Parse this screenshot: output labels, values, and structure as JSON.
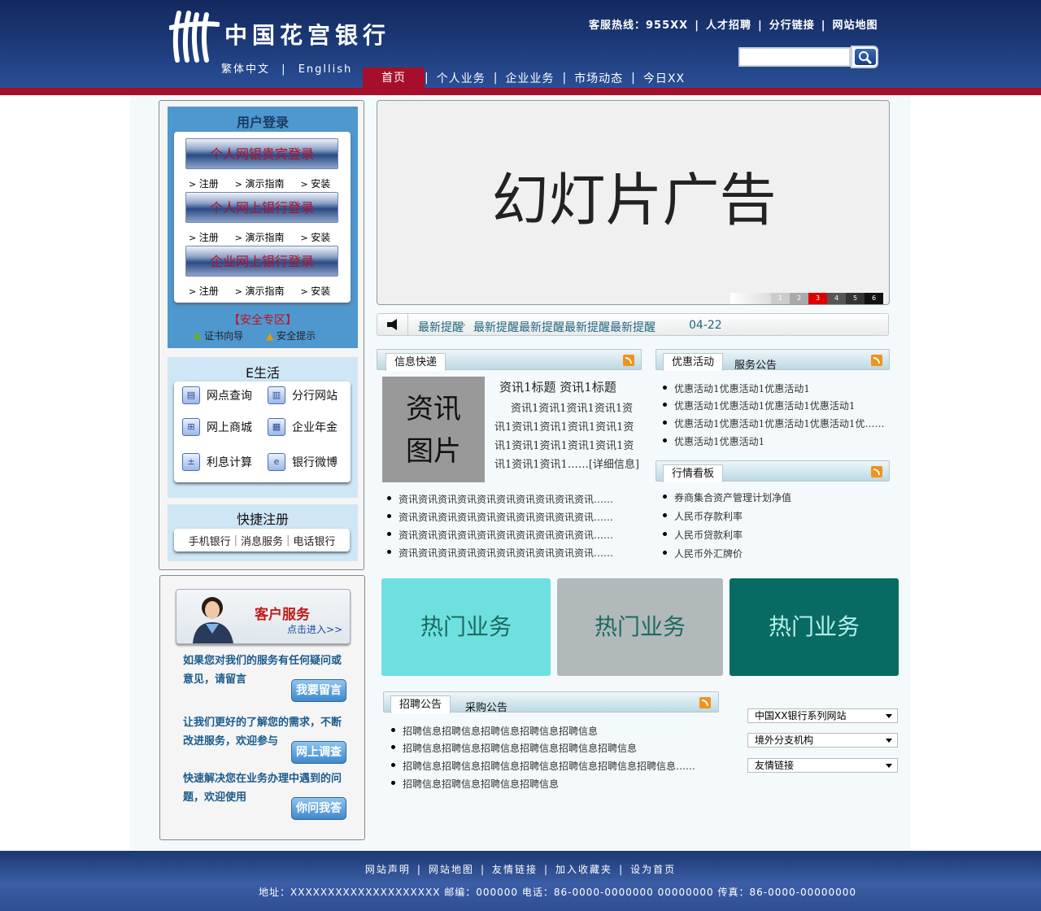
{
  "header": {
    "logo_text": "中国花宫银行",
    "lang_trad": "繁体中文",
    "lang_en": "Engllish",
    "top_links": [
      "客服热线：955XX",
      "人才招聘",
      "分行链接",
      "网站地图"
    ],
    "nav": [
      "首页",
      "个人业务",
      "企业业务",
      "市场动态",
      "今日XX"
    ],
    "search_placeholder": ""
  },
  "login": {
    "title": "用户登录",
    "buttons": [
      "个人网银贵宾登录",
      "个人网上银行登录",
      "企业网上银行登录"
    ],
    "links": [
      "注册",
      "演示指南",
      "安装"
    ],
    "safe_title": "【安全专区】",
    "safe_links": [
      "证书向导",
      "安全提示"
    ]
  },
  "elife": {
    "title": "E生活",
    "items": [
      "网点查询",
      "分行网站",
      "网上商城",
      "企业年金",
      "利息计算",
      "银行微博"
    ]
  },
  "quickreg": {
    "title": "快捷注册",
    "items": [
      "手机银行",
      "消息服务",
      "电话银行"
    ]
  },
  "cs": {
    "title": "客户服务",
    "sub": "点击进入>>",
    "blocks": [
      {
        "text": "如果您对我们的服务有任何疑问或意见，请留言",
        "button": "我要留言"
      },
      {
        "text": "让我们更好的了解您的需求，不断改进服务，欢迎参与",
        "button": "网上调查"
      },
      {
        "text": "快速解决您在业务办理中遇到的问题，欢迎使用",
        "button": "你问我答"
      }
    ]
  },
  "slide": {
    "text": "幻灯片广告",
    "pages": [
      "1",
      "2",
      "3",
      "4",
      "5",
      "6"
    ],
    "active_page": "3"
  },
  "ticker": {
    "label": "最新提醒",
    "text": "最新提醒最新提醒最新提醒最新提醒",
    "date": "04-22"
  },
  "info": {
    "tab": "信息快递",
    "pic_text": [
      "资讯",
      "图片"
    ],
    "title": "资讯1标题  资讯1标题",
    "body": "资讯1资讯1资讯1资讯1资讯1资讯1资讯1资讯1资讯1资讯1资讯1资讯1资讯1资讯1资讯1资讯1资讯1……[详细信息]",
    "list": [
      "资讯资讯资讯资讯资讯资讯资讯资讯资讯资讯……",
      "资讯资讯资讯资讯资讯资讯资讯资讯资讯资讯……",
      "资讯资讯资讯资讯资讯资讯资讯资讯资讯资讯……",
      "资讯资讯资讯资讯资讯资讯资讯资讯资讯资讯……"
    ]
  },
  "promo": {
    "tab_active": "优惠活动",
    "tab_other": "服务公告",
    "list": [
      "优惠活动1优惠活动1优惠活动1",
      "优惠活动1优惠活动1优惠活动1优惠活动1",
      "优惠活动1优惠活动1优惠活动1优惠活动1优……",
      "优惠活动1优惠活动1"
    ]
  },
  "market": {
    "tab": "行情看板",
    "list": [
      "券商集合资产管理计划净值",
      "人民币存款利率",
      "人民币贷款利率",
      "人民币外汇牌价"
    ]
  },
  "hot": {
    "tiles": [
      {
        "label": "热门业务",
        "bg": "#6ee0e0",
        "fg": "#1c6a62"
      },
      {
        "label": "热门业务",
        "bg": "#b2b9bb",
        "fg": "#1c6a62"
      },
      {
        "label": "热门业务",
        "bg": "#086b63",
        "fg": "#b8f0ea"
      }
    ]
  },
  "recruit": {
    "tab_active": "招聘公告",
    "tab_other": "采购公告",
    "list": [
      "招聘信息招聘信息招聘信息招聘信息招聘信息",
      "招聘信息招聘信息招聘信息招聘信息招聘信息招聘信息",
      "招聘信息招聘信息招聘信息招聘信息招聘信息招聘信息招聘信息……",
      "招聘信息招聘信息招聘信息招聘信息"
    ]
  },
  "selects": [
    "中国XX银行系列网站",
    "境外分支机构",
    "友情链接"
  ],
  "footer": {
    "links": [
      "网站声明",
      "网站地图",
      "友情链接",
      "加入收藏夹",
      "设为首页"
    ],
    "address": "地址：XXXXXXXXXXXXXXXXXXXX  邮编：000000  电话：86-0000-0000000 00000000  传真：86-0000-00000000"
  },
  "colors": {
    "brand_blue": "#1c3a78",
    "brand_red": "#a50f2b",
    "link_teal": "#1f6680"
  }
}
